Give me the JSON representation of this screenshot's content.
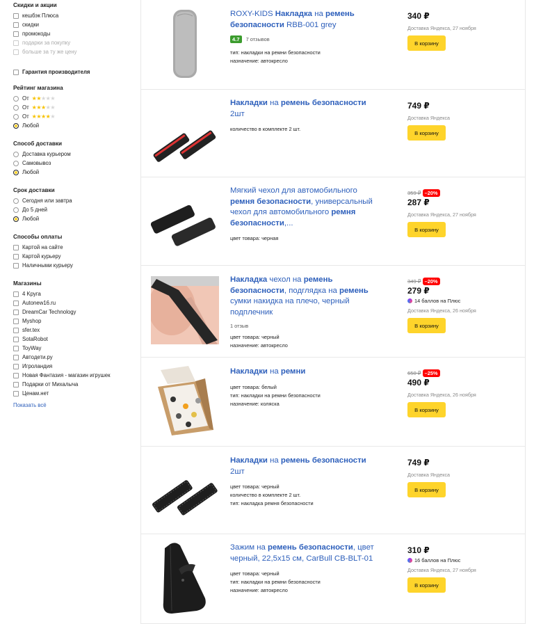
{
  "filters": {
    "promo": {
      "title": "Скидки и акции",
      "options": [
        "кешбэк Плюса",
        "скидки",
        "промокоды"
      ],
      "disabled_options": [
        "подарки за покупку",
        "больше за ту же цену"
      ]
    },
    "warranty": {
      "label": "Гарантия производителя"
    },
    "shop_rating": {
      "title": "Рейтинг магазина",
      "options": [
        {
          "label": "От",
          "stars": 2
        },
        {
          "label": "От",
          "stars": 3
        },
        {
          "label": "От",
          "stars": 4
        },
        {
          "label": "Любой"
        }
      ],
      "selected": 3
    },
    "delivery_method": {
      "title": "Способ доставки",
      "options": [
        "Доставка курьером",
        "Самовывоз",
        "Любой"
      ],
      "selected": 2
    },
    "delivery_time": {
      "title": "Срок доставки",
      "options": [
        "Сегодня или завтра",
        "До 5 дней",
        "Любой"
      ],
      "selected": 2
    },
    "payment": {
      "title": "Способы оплаты",
      "options": [
        "Картой на сайте",
        "Картой курьеру",
        "Наличными курьеру"
      ]
    },
    "shops": {
      "title": "Магазины",
      "options": [
        "4 Kруга",
        "Autonew16.ru",
        "DreamCar Technology",
        "Myshop",
        "sfer.tex",
        "SotaRobot",
        "ToyWay",
        "Автодети.ру",
        "Игроландия",
        "Новая Фантазия - магазин игрушек",
        "Подарки от Михалыча",
        "Ценам.нет"
      ],
      "show_all": "Показать всё"
    }
  },
  "products": [
    {
      "title_parts": [
        {
          "t": "ROXY-KIDS ",
          "b": false
        },
        {
          "t": "Накладка",
          "b": true
        },
        {
          "t": " на ",
          "b": false
        },
        {
          "t": "ремень безопасности",
          "b": true
        },
        {
          "t": " RBB-001 grey",
          "b": false
        }
      ],
      "rating": "4.7",
      "rating_text": "7 отзывов",
      "specs": [
        "тип: накладки на ремни безопасности",
        "назначение: автокресло"
      ],
      "price": "340 ₽",
      "delivery": "Доставка Яндекса, 27 ноября",
      "cart": "В корзину"
    },
    {
      "title_parts": [
        {
          "t": "Накладки",
          "b": true
        },
        {
          "t": " на ",
          "b": false
        },
        {
          "t": "ремень безопасности",
          "b": true
        },
        {
          "t": " 2шт",
          "b": false
        }
      ],
      "specs": [
        "количество в комплекте 2 шт."
      ],
      "price": "749 ₽",
      "delivery": "Доставка Яндекса",
      "cart": "В корзину"
    },
    {
      "title_parts": [
        {
          "t": "Мягкий чехол для автомобильного ",
          "b": false
        },
        {
          "t": "ремня безопасности",
          "b": true
        },
        {
          "t": ", универсальный чехол для автомобильного ",
          "b": false
        },
        {
          "t": "ремня безопасности",
          "b": true
        },
        {
          "t": ",...",
          "b": false
        }
      ],
      "specs": [
        "цвет товара: черная"
      ],
      "old_price": "359 ₽",
      "discount": "–20%",
      "price": "287 ₽",
      "delivery": "Доставка Яндекса, 27 ноября",
      "cart": "В корзину"
    },
    {
      "title_parts": [
        {
          "t": "Накладка",
          "b": true
        },
        {
          "t": " чехол на ",
          "b": false
        },
        {
          "t": "ремень безопасности",
          "b": true
        },
        {
          "t": ", подглядка на ",
          "b": false
        },
        {
          "t": "ремень",
          "b": true
        },
        {
          "t": " сумки накидка на плечо, черный подплечник",
          "b": false
        }
      ],
      "reviews": "1 отзыв",
      "specs": [
        "цвет товара: черный",
        "назначение: автокресло"
      ],
      "old_price": "349 ₽",
      "discount": "–20%",
      "price": "279 ₽",
      "plus": "14 баллов на Плюс",
      "delivery": "Доставка Яндекса, 26 ноября",
      "cart": "В корзину"
    },
    {
      "title_parts": [
        {
          "t": "Накладки",
          "b": true
        },
        {
          "t": " на ",
          "b": false
        },
        {
          "t": "ремни",
          "b": true
        }
      ],
      "specs": [
        "цвет товара: белый",
        "тип: накладки на ремни безопасности",
        "назначение: коляска"
      ],
      "old_price": "650 ₽",
      "discount": "–25%",
      "price": "490 ₽",
      "delivery": "Доставка Яндекса, 26 ноября",
      "cart": "В корзину"
    },
    {
      "title_parts": [
        {
          "t": "Накладки",
          "b": true
        },
        {
          "t": " на ",
          "b": false
        },
        {
          "t": "ремень безопасности",
          "b": true
        },
        {
          "t": " 2шт",
          "b": false
        }
      ],
      "specs": [
        "цвет товара: черный",
        "количество в комплекте 2 шт.",
        "тип: накладка ремня безопасности"
      ],
      "price": "749 ₽",
      "delivery": "Доставка Яндекса",
      "cart": "В корзину"
    },
    {
      "title_parts": [
        {
          "t": "Зажим на ",
          "b": false
        },
        {
          "t": "ремень безопасности",
          "b": true
        },
        {
          "t": ", цвет черный, 22,5x15 см, CarBull CB-BLT-01",
          "b": false
        }
      ],
      "specs": [
        "цвет товара: черный",
        "тип: накладки на ремни безопасности",
        "назначение: автокресло"
      ],
      "price": "310 ₽",
      "plus": "16 баллов на Плюс",
      "delivery": "Доставка Яндекса, 27 ноября",
      "cart": "В корзину"
    }
  ]
}
